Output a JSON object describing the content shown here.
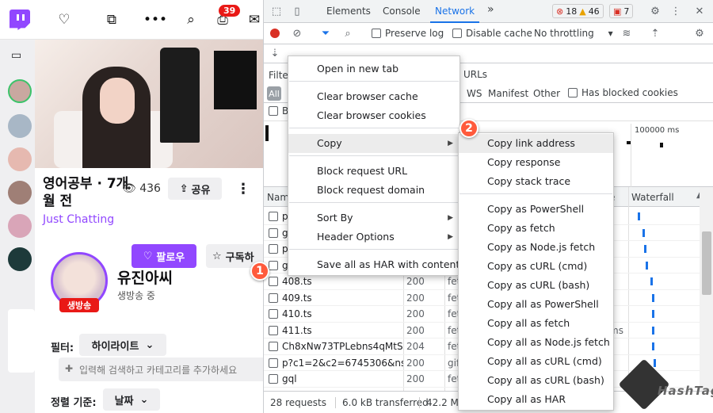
{
  "twitch": {
    "notif_count": "39",
    "stream_title": "영어공부 · 7개월 전",
    "views": "436",
    "share": "공유",
    "category": "Just Chatting",
    "follow": "팔로우",
    "subscribe": "구독하",
    "channel_name": "유진아씨",
    "live_badge": "생방송",
    "channel_status": "생방송 중",
    "filter_label": "필터:",
    "filter_value": "하이라이트",
    "search_placeholder": "입력해 검색하고 카테고리를 추가하세요",
    "sort_label": "정렬 기준:",
    "sort_value": "날짜"
  },
  "devtools": {
    "tabs": [
      "Elements",
      "Console",
      "Network"
    ],
    "errors": "18",
    "warnings": "46",
    "issues": "7",
    "preserve_log": "Preserve log",
    "disable_cache": "Disable cache",
    "throttling": "No throttling",
    "filter_partial": "Filte",
    "urls_partial": "URLs",
    "all": "All",
    "type_filters": [
      "WS",
      "Manifest",
      "Other"
    ],
    "has_blocked_cookies": "Has blocked cookies",
    "b_partial": "B",
    "overview_label": "100000 ms",
    "col_name": "Nam",
    "col_waterfall": "Waterfall",
    "col_time_partial": "e",
    "rows": [
      {
        "name": "p",
        "status": "",
        "type": "",
        "time": ""
      },
      {
        "name": "g",
        "status": "",
        "type": "",
        "time": ""
      },
      {
        "name": "p",
        "status": "",
        "type": "",
        "time": ""
      },
      {
        "name": "g",
        "status": "",
        "type": "",
        "time": ""
      },
      {
        "name": "408.ts",
        "status": "200",
        "type": "fet",
        "time": ""
      },
      {
        "name": "409.ts",
        "status": "200",
        "type": "fet",
        "time": ""
      },
      {
        "name": "410.ts",
        "status": "200",
        "type": "fet",
        "time": ""
      },
      {
        "name": "411.ts",
        "status": "200",
        "type": "fet",
        "time": "ms"
      },
      {
        "name": "Ch8xNw73TPLebns4qMtS...",
        "status": "204",
        "type": "fet",
        "time": ""
      },
      {
        "name": "p?c1=2&c2=6745306&ns...",
        "status": "200",
        "type": "gif",
        "time": ""
      },
      {
        "name": "gql",
        "status": "200",
        "type": "fet",
        "time": ""
      }
    ],
    "requests": "28 requests",
    "transferred": "6.0 kB transferred",
    "resources": "42.2 M"
  },
  "menu1": {
    "items": [
      "Open in new tab",
      "Clear browser cache",
      "Clear browser cookies",
      "Copy",
      "Block request URL",
      "Block request domain",
      "Sort By",
      "Header Options",
      "Save all as HAR with content"
    ]
  },
  "menu2": {
    "items": [
      "Copy link address",
      "Copy response",
      "Copy stack trace",
      "Copy as PowerShell",
      "Copy as fetch",
      "Copy as Node.js fetch",
      "Copy as cURL (cmd)",
      "Copy as cURL (bash)",
      "Copy all as PowerShell",
      "Copy all as fetch",
      "Copy all as Node.js fetch",
      "Copy all as cURL (cmd)",
      "Copy all as cURL (bash)",
      "Copy all as HAR"
    ]
  },
  "steps": [
    "1",
    "2"
  ],
  "watermark": "HashTag",
  "colors": {
    "twitch_purple": "#9147ff",
    "devtools_blue": "#1a73e8",
    "step_badge": "#ff5a3c",
    "live_red": "#e91916"
  }
}
